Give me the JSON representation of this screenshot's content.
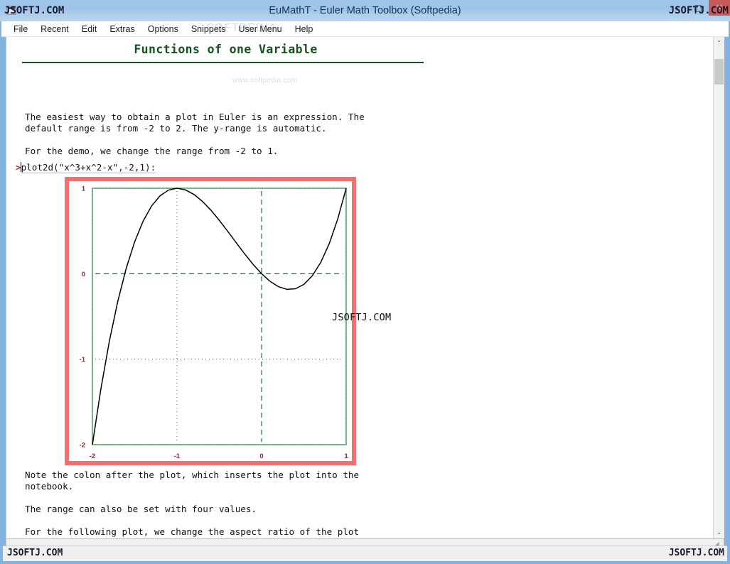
{
  "window": {
    "title": "EuMathT - Euler Math Toolbox (Softpedia)",
    "icon": "app-icon",
    "controls": {
      "minimize": "–",
      "maximize": "□",
      "close": "✕"
    },
    "frame_color": "#83b3e0",
    "titlebar_color": "#9cc4e8",
    "close_button_color": "#c75b5b"
  },
  "menubar": {
    "items": [
      {
        "label": "File"
      },
      {
        "label": "Recent"
      },
      {
        "label": "Edit"
      },
      {
        "label": "Extras"
      },
      {
        "label": "Options"
      },
      {
        "label": "Snippets"
      },
      {
        "label": "User Menu"
      },
      {
        "label": "Help"
      }
    ],
    "watermark": "SOFTPEDIA"
  },
  "notebook": {
    "heading": "Functions of one Variable",
    "heading_color": "#14531d",
    "softpedia_watermark": "www.softpedia.com",
    "paragraph_1": "The easiest way to obtain a plot in Euler is an expression. The\ndefault range is from -2 to 2. The y-range is automatic.",
    "paragraph_2": "For the demo, we change the range from -2 to 1.",
    "paragraph_3": "Note the colon after the plot, which inserts the plot into the\nnotebook.",
    "paragraph_4": "The range can also be set with four values.",
    "paragraph_5": "For the following plot, we change the aspect ratio of the plot\nlocally. To plot more than one functions, the easiest way is to use an\narray of expressions.",
    "command": {
      "prompt": ">",
      "text": "plot2d(\"x^3+x^2-x\",-2,1):"
    }
  },
  "chart_data": {
    "type": "line",
    "title": "",
    "xlabel": "",
    "ylabel": "",
    "expression": "x^3+x^2-x",
    "xlim": [
      -2,
      1
    ],
    "ylim": [
      -2,
      1
    ],
    "xticks": [
      -2,
      -1,
      0,
      1
    ],
    "xtick_labels": [
      "-2",
      "-1",
      "0",
      "1"
    ],
    "yticks": [
      -2,
      -1,
      0,
      1
    ],
    "ytick_labels": [
      "-2",
      "-1",
      "0",
      "1"
    ],
    "grid": true,
    "grid_color": "#2d7a43",
    "grid_style": "dotted",
    "axis_line_color": "#2d7a43",
    "axis_line_style": "dashed",
    "frame_color": "#3f9b5a",
    "tick_label_color": "#8b2b2b",
    "curve_color": "#000000",
    "selection_border_color": "#f0726e",
    "legend": null,
    "series": [
      {
        "name": "x^3+x^2-x",
        "x": [
          -2.0,
          -1.9,
          -1.8,
          -1.7,
          -1.6,
          -1.5,
          -1.4,
          -1.3,
          -1.2,
          -1.1,
          -1.0,
          -0.9,
          -0.8,
          -0.7,
          -0.6,
          -0.5,
          -0.4,
          -0.3,
          -0.2,
          -0.1,
          0.0,
          0.1,
          0.2,
          0.3,
          0.4,
          0.5,
          0.6,
          0.7,
          0.8,
          0.9,
          1.0
        ],
        "y": [
          -2.0,
          -1.349,
          -0.792,
          -0.323,
          0.064,
          0.375,
          0.616,
          0.793,
          0.912,
          0.979,
          1.0,
          0.981,
          0.928,
          0.847,
          0.744,
          0.625,
          0.496,
          0.363,
          0.232,
          0.109,
          0.0,
          -0.089,
          -0.152,
          -0.183,
          -0.176,
          -0.125,
          -0.024,
          0.133,
          0.352,
          0.639,
          1.0
        ]
      }
    ]
  },
  "watermarks": {
    "title_left": "JSOFTJ.COM",
    "title_right": "JSOFTJ.COM",
    "plot": "JSOFTJ.COM",
    "status_left": "JSOFTJ.COM",
    "status_right": "JSOFTJ.COM"
  },
  "scrollbar": {
    "up_arrow": "⌃",
    "down_arrow": "⌄"
  },
  "statusbar": {
    "resize_grip": "◢"
  }
}
